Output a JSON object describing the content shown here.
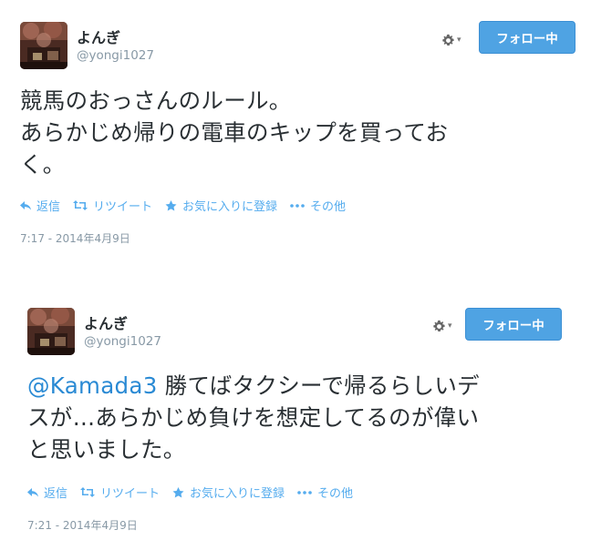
{
  "tweets": [
    {
      "user": {
        "name": "よんぎ",
        "handle": "@yongi1027"
      },
      "follow_label": "フォロー中",
      "text_lines": [
        "競馬のおっさんのルール。",
        "あらかじめ帰りの電車のキップを買ってお",
        "く。"
      ],
      "actions": {
        "reply": "返信",
        "retweet": "リツイート",
        "favorite": "お気に入りに登録",
        "more": "その他"
      },
      "timestamp": "7:17 - 2014年4月9日"
    },
    {
      "user": {
        "name": "よんぎ",
        "handle": "@yongi1027"
      },
      "follow_label": "フォロー中",
      "mention": "@Kamada3",
      "text_lines": [
        " 勝てばタクシーで帰るらしいデ",
        "スが…あらかじめ負けを想定してるのが偉い",
        "と思いました。"
      ],
      "actions": {
        "reply": "返信",
        "retweet": "リツイート",
        "favorite": "お気に入りに登録",
        "more": "その他"
      },
      "timestamp": "7:21 - 2014年4月9日"
    }
  ],
  "colors": {
    "link": "#55acee",
    "follow_bg": "#4fa3e3",
    "meta": "#8899a6",
    "text": "#292f33"
  },
  "icons": [
    "gear-icon",
    "reply-icon",
    "retweet-icon",
    "star-icon",
    "more-icon",
    "avatar"
  ]
}
